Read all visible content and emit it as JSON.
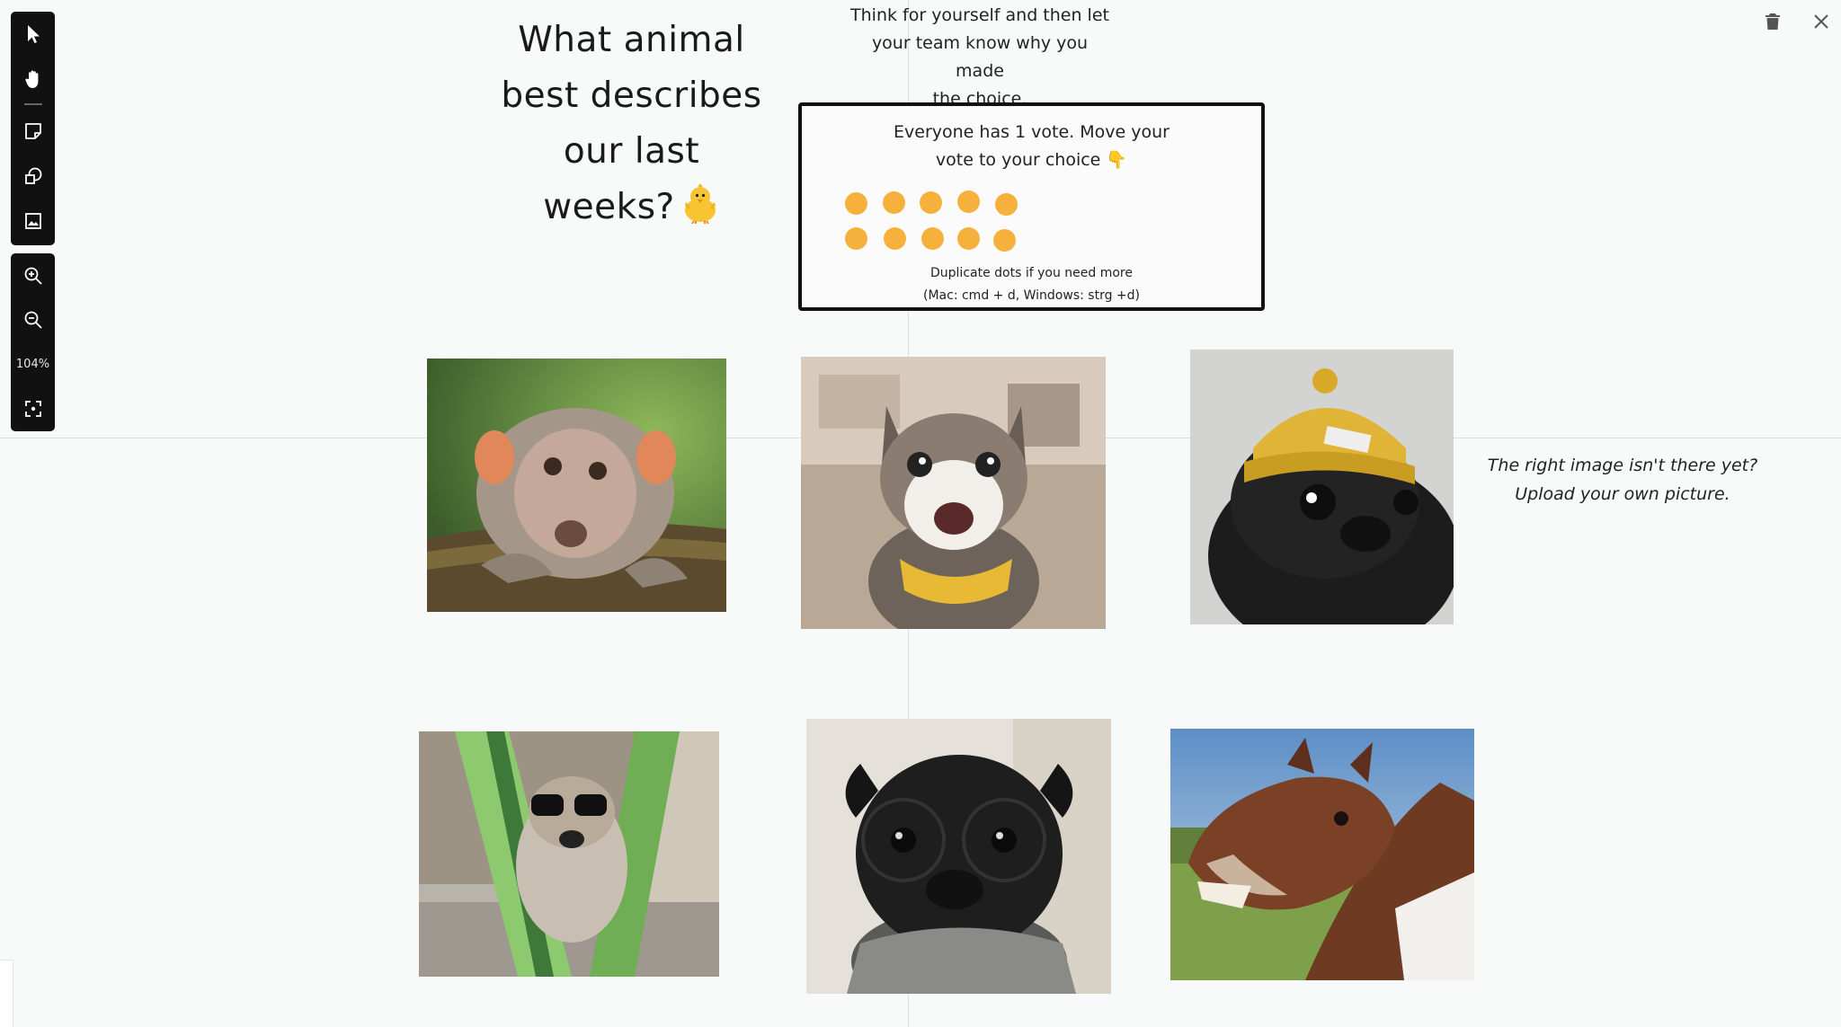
{
  "toolbar": {
    "zoom_level": "104%",
    "tools": [
      "select-tool",
      "hand-tool",
      "sticky-note-tool",
      "shape-tool",
      "image-tool"
    ],
    "zoom_tools": [
      "zoom-in",
      "zoom-out",
      "fit-to-screen"
    ]
  },
  "header_icons": [
    "trash-icon",
    "close-icon"
  ],
  "board": {
    "title_lines": [
      "What animal",
      "best describes",
      "our last",
      "weeks?"
    ],
    "title_emoji": "chick",
    "instruction_lines": [
      "Think for yourself and then let",
      "your team know why you made",
      "the choice."
    ],
    "vote_box": {
      "title_lines": [
        "Everyone has 1 vote. Move your",
        "vote to your choice 👇"
      ],
      "note_lines": [
        "Duplicate dots if you need more",
        "(Mac: cmd + d, Windows: strg +d)"
      ],
      "dot_count": 10,
      "dot_color": "#f5b13c"
    },
    "side_note_lines": [
      "The right image isn't there yet?",
      "Upload your own picture."
    ],
    "images": [
      "monkey",
      "cat",
      "pug-with-beanie",
      "dog-in-hammock",
      "pug-with-glasses",
      "horse"
    ]
  },
  "colors": {
    "background": "#f8f9f9",
    "toolbar": "#111111",
    "guide": "#dcdfe1"
  }
}
